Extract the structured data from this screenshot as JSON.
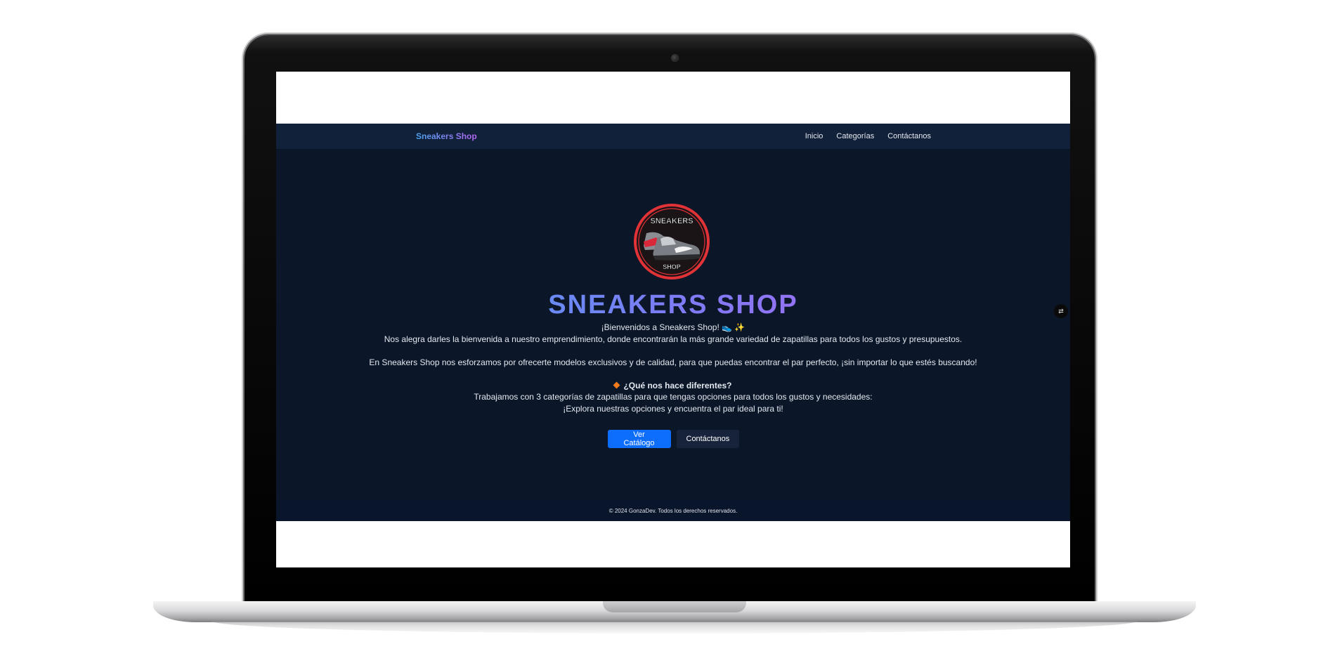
{
  "navbar": {
    "brand": "Sneakers Shop",
    "links": [
      "Inicio",
      "Categorías",
      "Contáctanos"
    ]
  },
  "logo": {
    "top_text": "SNEAKERS",
    "bottom_text": "SHOP"
  },
  "hero": {
    "title": "SNEAKERS SHOP",
    "welcome": "¡Bienvenidos a Sneakers Shop! 👟 ✨",
    "intro": "Nos alegra darles la bienvenida a nuestro emprendimiento, donde encontrarán la más grande variedad de zapatillas para todos los gustos y presupuestos.",
    "mission": "En Sneakers Shop nos esforzamos por ofrecerte modelos exclusivos y de calidad, para que puedas encontrar el par perfecto, ¡sin importar lo que estés buscando!",
    "diff_title": "¿Qué nos hace diferentes?",
    "diff_text": "Trabajamos con 3 categorías de zapatillas para que tengas opciones para todos los gustos y necesidades:",
    "explore": "¡Explora nuestras opciones y encuentra el par ideal para ti!",
    "buttons": {
      "catalog": "Ver Catálogo",
      "contact": "Contáctanos"
    }
  },
  "widget": {
    "icon": "translate-icon",
    "glyph": "⇄"
  },
  "footer": {
    "text": "© 2024 GonzaDev. Todos los derechos reservados."
  },
  "colors": {
    "background": "#0b1729",
    "navbar": "#12213a",
    "primary_button": "#0d6efd",
    "gradient_start": "#3ea8f5",
    "gradient_end": "#c35ef2"
  }
}
